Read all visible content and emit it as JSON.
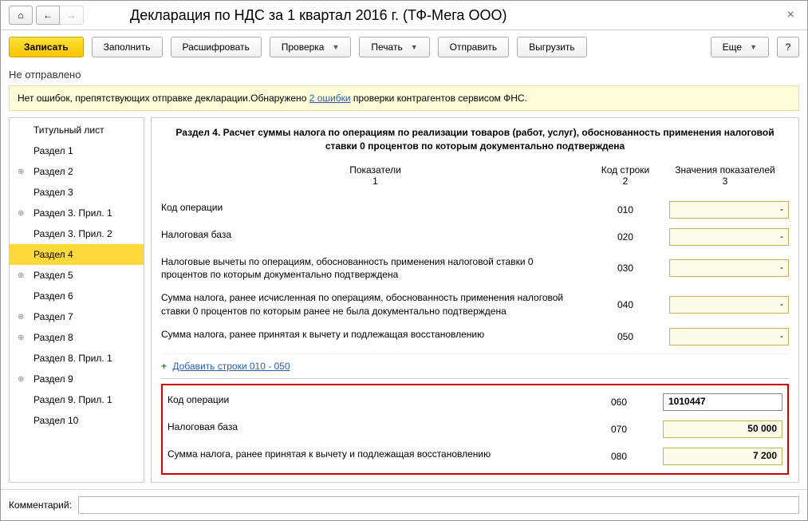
{
  "title": "Декларация по НДС за 1 квартал 2016 г. (ТФ-Мега ООО)",
  "toolbar": {
    "save": "Записать",
    "fill": "Заполнить",
    "decode": "Расшифровать",
    "check": "Проверка",
    "print": "Печать",
    "send": "Отправить",
    "export": "Выгрузить",
    "more": "Еще",
    "help": "?"
  },
  "status": "Не отправлено",
  "notice": {
    "prefix": "Нет ошибок, препятствующих отправке декларации.Обнаружено ",
    "link": "2 ошибки",
    "suffix": " проверки контрагентов сервисом ФНС."
  },
  "sidebar": [
    {
      "label": "Титульный лист",
      "expand": false
    },
    {
      "label": "Раздел 1",
      "expand": false
    },
    {
      "label": "Раздел 2",
      "expand": true
    },
    {
      "label": "Раздел 3",
      "expand": false
    },
    {
      "label": "Раздел 3. Прил. 1",
      "expand": true
    },
    {
      "label": "Раздел 3. Прил. 2",
      "expand": false
    },
    {
      "label": "Раздел 4",
      "expand": false,
      "active": true
    },
    {
      "label": "Раздел 5",
      "expand": true
    },
    {
      "label": "Раздел 6",
      "expand": false
    },
    {
      "label": "Раздел 7",
      "expand": true
    },
    {
      "label": "Раздел 8",
      "expand": true
    },
    {
      "label": "Раздел 8. Прил. 1",
      "expand": false
    },
    {
      "label": "Раздел 9",
      "expand": true
    },
    {
      "label": "Раздел 9. Прил. 1",
      "expand": false
    },
    {
      "label": "Раздел 10",
      "expand": false
    }
  ],
  "section": {
    "title": "Раздел 4. Расчет суммы налога по операциям по реализации товаров (работ, услуг), обоснованность применения налоговой ставки 0 процентов по которым документально подтверждена",
    "headers": {
      "col1": "Показатели",
      "col1n": "1",
      "col2": "Код строки",
      "col2n": "2",
      "col3": "Значения показателей",
      "col3n": "3"
    },
    "rows": [
      {
        "label": "Код операции",
        "code": "010"
      },
      {
        "label": "Налоговая база",
        "code": "020"
      },
      {
        "label": "Налоговые вычеты по операциям, обоснованность применения налоговой ставки 0 процентов по которым документально подтверждена",
        "code": "030"
      },
      {
        "label": "Сумма налога, ранее исчисленная по операциям, обоснованность применения налоговой ставки 0 процентов по которым ранее не была документально подтверждена",
        "code": "040"
      },
      {
        "label": "Сумма налога, ранее принятая к вычету и подлежащая восстановлению",
        "code": "050"
      }
    ],
    "addLink": "Добавить строки 010 - 050",
    "highlighted": [
      {
        "label": "Код операции",
        "code": "060",
        "value": "1010447",
        "plain": true
      },
      {
        "label": "Налоговая база",
        "code": "070",
        "value": "50 000"
      },
      {
        "label": "Сумма налога, ранее принятая к вычету и подлежащая восстановлению",
        "code": "080",
        "value": "7 200"
      }
    ]
  },
  "footer": {
    "label": "Комментарий:"
  }
}
